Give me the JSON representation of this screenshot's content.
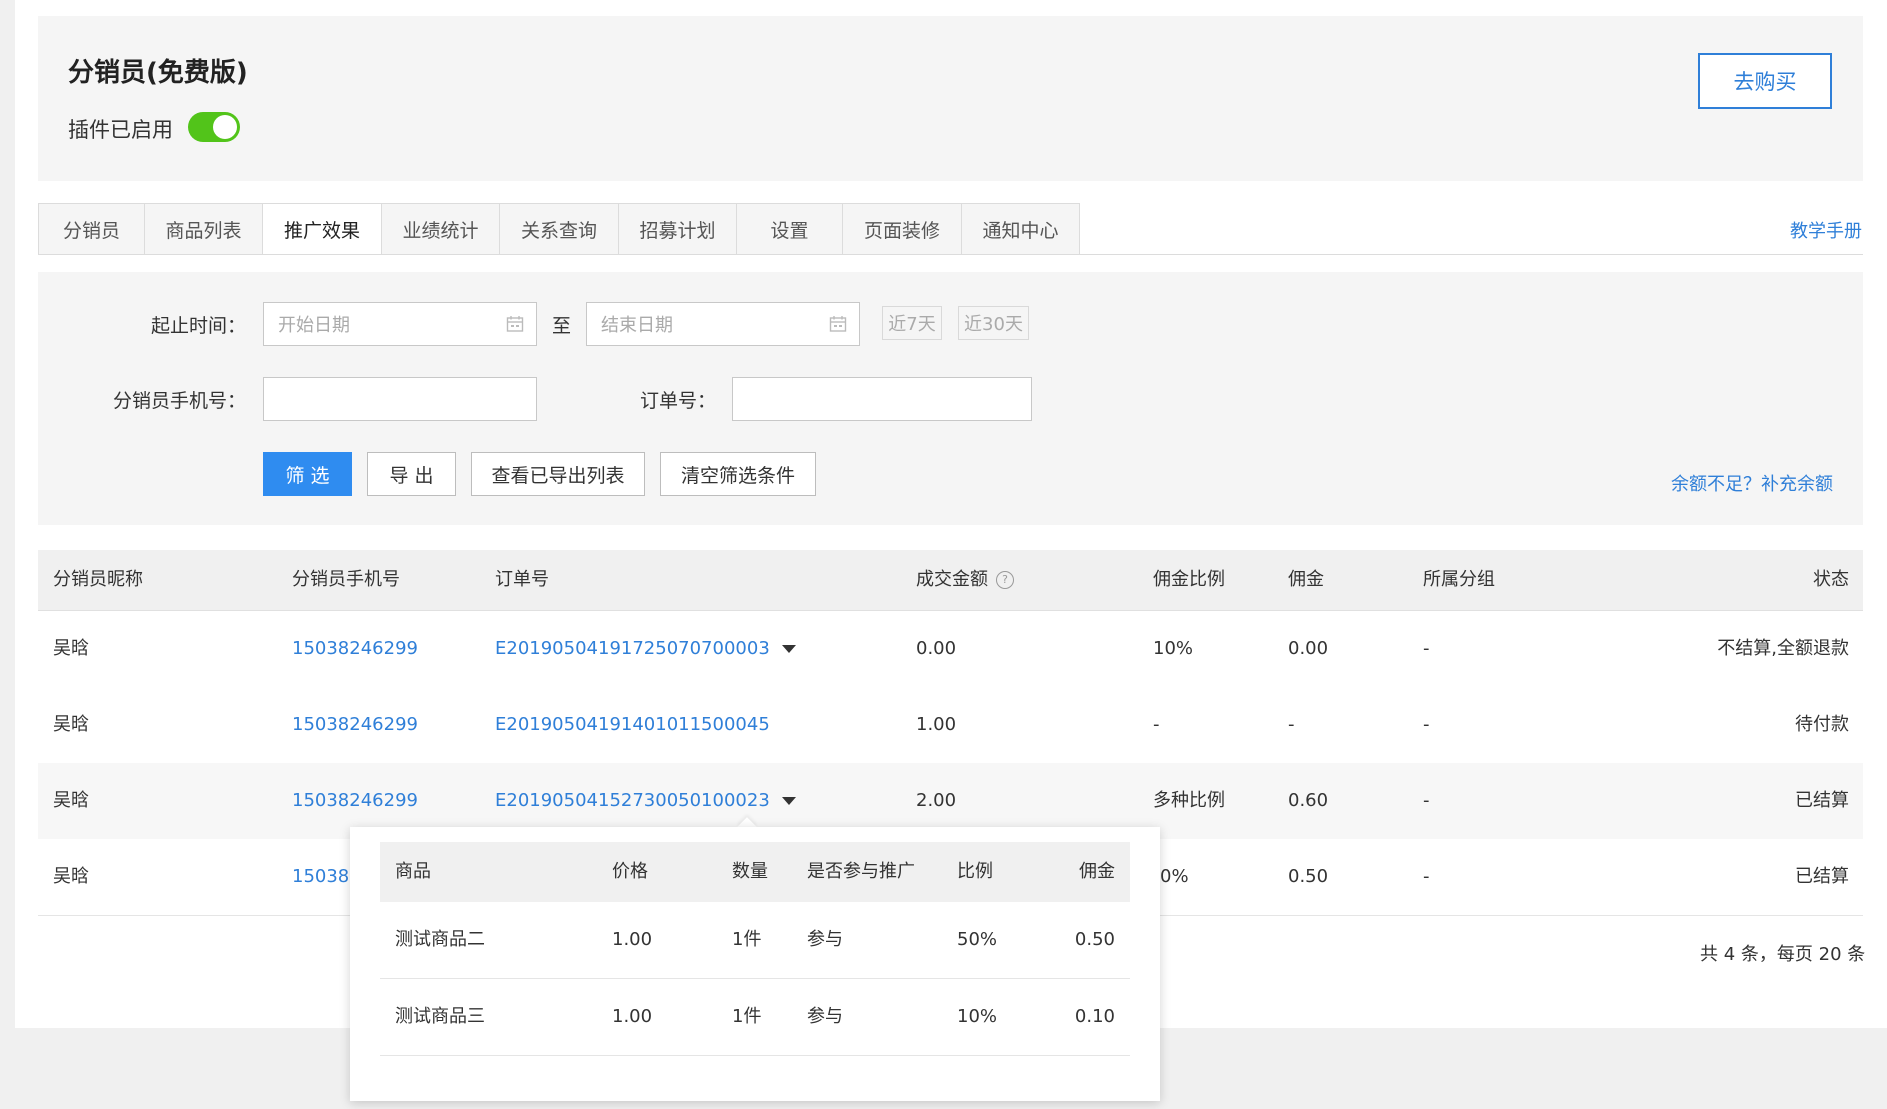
{
  "plugin": {
    "title": "分销员(免费版)",
    "status_label": "插件已启用",
    "enabled": true,
    "buy_label": "去购买"
  },
  "tabs": [
    {
      "label": "分销员"
    },
    {
      "label": "商品列表"
    },
    {
      "label": "推广效果",
      "active": true
    },
    {
      "label": "业绩统计"
    },
    {
      "label": "关系查询"
    },
    {
      "label": "招募计划"
    },
    {
      "label": "设置"
    },
    {
      "label": "页面装修"
    },
    {
      "label": "通知中心"
    }
  ],
  "manual_link": "教学手册",
  "filters": {
    "date_label": "起止时间：",
    "start_placeholder": "开始日期",
    "to_label": "至",
    "end_placeholder": "结束日期",
    "quick_7": "近7天",
    "quick_30": "近30天",
    "phone_label": "分销员手机号：",
    "phone_value": "",
    "order_label": "订单号：",
    "order_value": "",
    "btn_filter": "筛 选",
    "btn_export": "导 出",
    "btn_exported_list": "查看已导出列表",
    "btn_clear": "清空筛选条件",
    "topup_link": "余额不足？补充余额"
  },
  "table": {
    "headers": {
      "nickname": "分销员昵称",
      "phone": "分销员手机号",
      "order": "订单号",
      "amount": "成交金额",
      "rate": "佣金比例",
      "commission": "佣金",
      "group": "所属分组",
      "status": "状态"
    },
    "rows": [
      {
        "nickname": "吴晗",
        "phone": "15038246299",
        "order": "E20190504191725070700003",
        "amount": "0.00",
        "rate": "10%",
        "commission": "0.00",
        "group": "-",
        "status": "不结算,全额退款"
      },
      {
        "nickname": "吴晗",
        "phone": "15038246299",
        "order": "E20190504191401011500045",
        "amount": "1.00",
        "rate": "-",
        "commission": "-",
        "group": "-",
        "status": "待付款"
      },
      {
        "nickname": "吴晗",
        "phone": "15038246299",
        "order": "E20190504152730050100023",
        "amount": "2.00",
        "rate": "多种比例",
        "commission": "0.60",
        "group": "-",
        "status": "已结算"
      },
      {
        "nickname": "吴晗",
        "phone": "15038246299",
        "phone_visible": "150382",
        "order": "",
        "amount": "",
        "rate": "50%",
        "rate_visible": "0%",
        "commission": "0.50",
        "group": "-",
        "status": "已结算"
      }
    ],
    "pagination": "共 4 条，每页 20 条"
  },
  "popover": {
    "headers": {
      "product": "商品",
      "price": "价格",
      "qty": "数量",
      "promo": "是否参与推广",
      "ratio": "比例",
      "commission": "佣金"
    },
    "rows": [
      {
        "product": "测试商品二",
        "price": "1.00",
        "qty": "1件",
        "promo": "参与",
        "ratio": "50%",
        "commission": "0.50"
      },
      {
        "product": "测试商品三",
        "price": "1.00",
        "qty": "1件",
        "promo": "参与",
        "ratio": "10%",
        "commission": "0.10"
      }
    ]
  },
  "colors": {
    "accent": "#2f8cf0",
    "link": "#2f7fd8",
    "toggle_on": "#52c41a"
  }
}
